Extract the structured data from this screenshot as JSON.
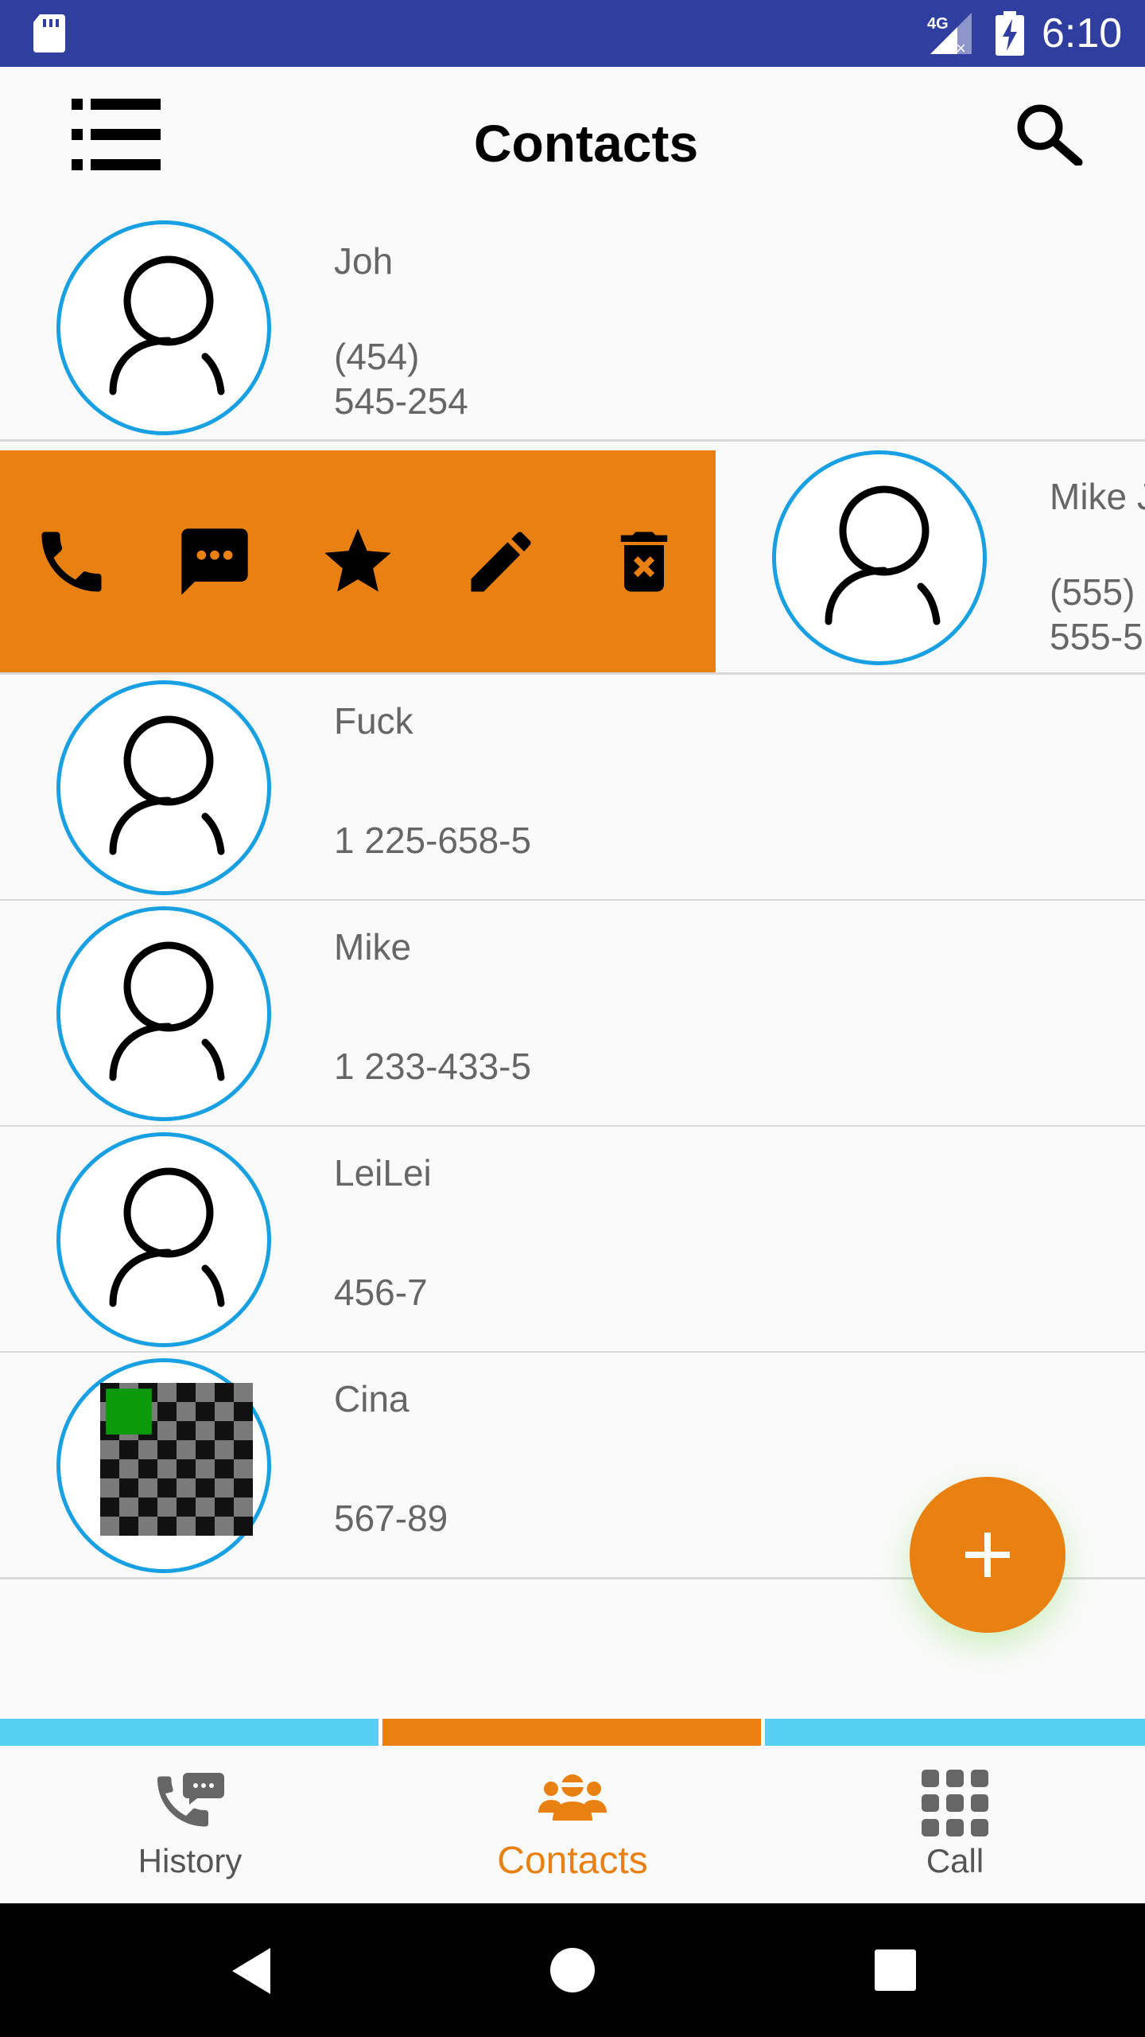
{
  "status_bar": {
    "time": "6:10",
    "network": "4G"
  },
  "app_bar": {
    "title": "Contacts"
  },
  "swiped_row": {
    "name": "Mike J",
    "phone": "(555) 555-5",
    "actions": [
      "call",
      "message",
      "favorite",
      "edit",
      "delete"
    ]
  },
  "contacts": [
    {
      "name": "Joh",
      "phone": "(454) 545-254"
    },
    {
      "name": "Fuck",
      "phone": "1 225-658-5"
    },
    {
      "name": "Mike",
      "phone": "1 233-433-5"
    },
    {
      "name": "LeiLei",
      "phone": "456-7"
    },
    {
      "name": "Cina",
      "phone": "567-89"
    }
  ],
  "bottom_nav": {
    "tabs": [
      {
        "label": "History",
        "active": false
      },
      {
        "label": "Contacts",
        "active": true
      },
      {
        "label": "Call",
        "active": false
      }
    ]
  },
  "colors": {
    "status_bar": "#303f9f",
    "accent": "#e98012",
    "avatar_border": "#18a0e2",
    "tab_indicator": "#55d0f2"
  }
}
